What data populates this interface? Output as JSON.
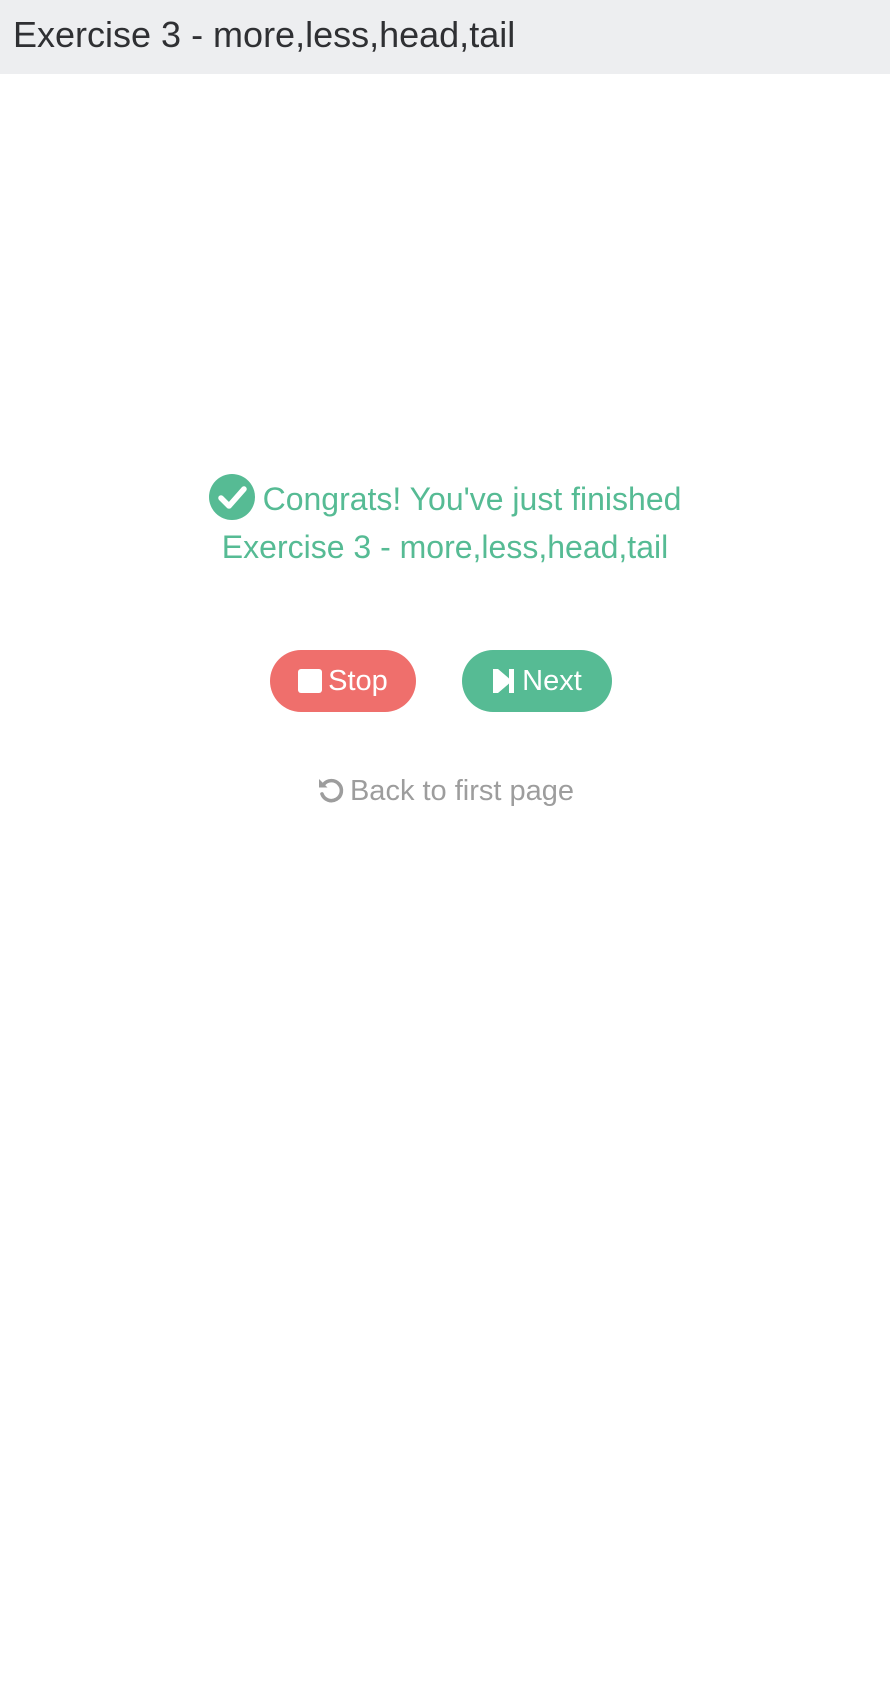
{
  "header": {
    "title": "Exercise 3 - more,less,head,tail"
  },
  "completion": {
    "line1": "Congrats! You've just finished",
    "line2": "Exercise 3 - more,less,head,tail",
    "icon": "check-circle-icon",
    "color": "#56bb94"
  },
  "actions": {
    "stop_label": "Stop",
    "stop_icon": "stop-icon",
    "stop_color": "#ef6f6c",
    "next_label": "Next",
    "next_icon": "step-forward-icon",
    "next_color": "#56bb94"
  },
  "back": {
    "label": "Back to first page",
    "icon": "undo-icon",
    "color": "#9d9d9d"
  },
  "colors": {
    "header_bg": "#edeef0",
    "header_text": "#2f3033"
  }
}
